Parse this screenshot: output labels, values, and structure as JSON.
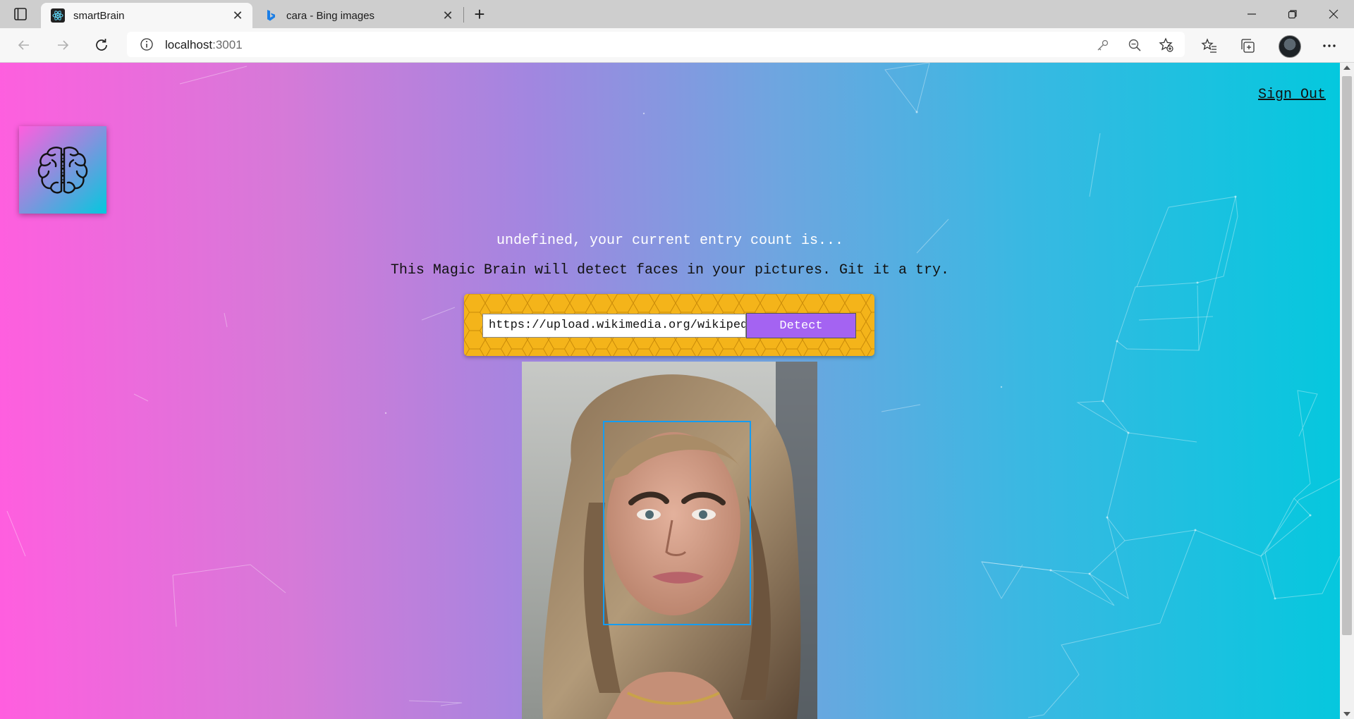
{
  "browser": {
    "tabs": [
      {
        "title": "smartBrain",
        "active": true,
        "icon": "react-icon"
      },
      {
        "title": "cara - Bing images",
        "active": false,
        "icon": "bing-icon"
      }
    ],
    "address": {
      "host": "localhost",
      "port": ":3001"
    },
    "window_controls": [
      "minimize",
      "restore",
      "close"
    ]
  },
  "page": {
    "nav": {
      "sign_out": "Sign Out"
    },
    "entry_text": "undefined, your current entry count is...",
    "intro_text": "This Magic Brain will detect faces in your pictures. Git it a try.",
    "form": {
      "input_value": "https://upload.wikimedia.org/wikiped",
      "button_label": "Detect"
    },
    "colors": {
      "gradient_start": "#ff5edf",
      "gradient_end": "#04c8de",
      "form_bg": "#f4b41a",
      "button_bg": "#a463f2",
      "face_box": "#149df2"
    },
    "image_alt": "face-detection-result"
  }
}
